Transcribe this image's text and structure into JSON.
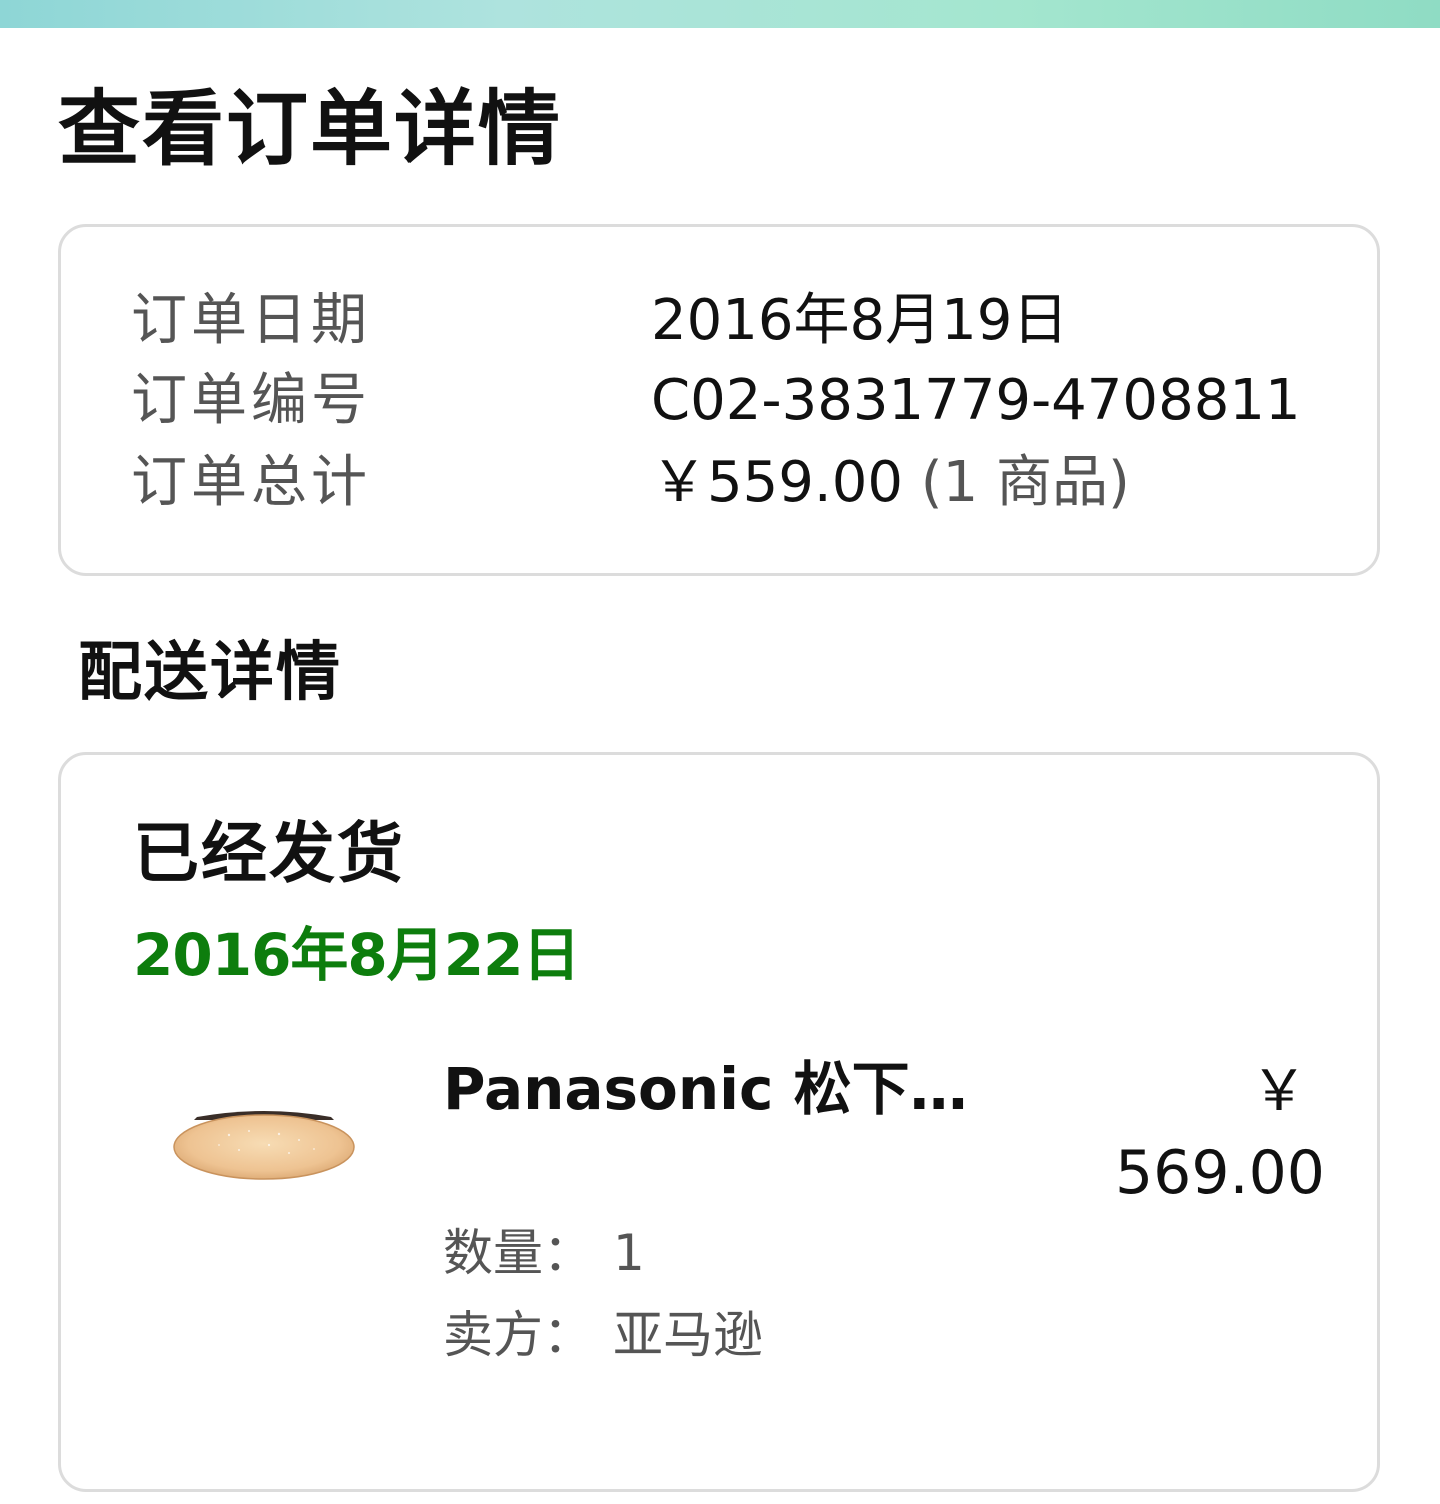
{
  "page": {
    "title": "查看订单详情"
  },
  "summary": {
    "order_date_label": "订单日期",
    "order_date_value": "2016年8月19日",
    "order_number_label": "订单编号",
    "order_number_value": "C02-3831779-4708811",
    "order_total_label": "订单总计",
    "order_total_value": "￥559.00",
    "order_total_items": "(1 商品)"
  },
  "delivery": {
    "section_title": "配送详情",
    "status": "已经发货",
    "date": "2016年8月22日",
    "item": {
      "name": "Panasonic 松下…",
      "currency": "￥",
      "price": "569.00",
      "quantity_label": "数量：",
      "quantity_value": "1",
      "seller_label": "卖方：",
      "seller_value": "亚马逊",
      "image_icon": "ceiling-lamp"
    }
  },
  "colors": {
    "accent_green": "#0d7d0d",
    "border": "#dcdcdc",
    "label_gray": "#555555"
  }
}
